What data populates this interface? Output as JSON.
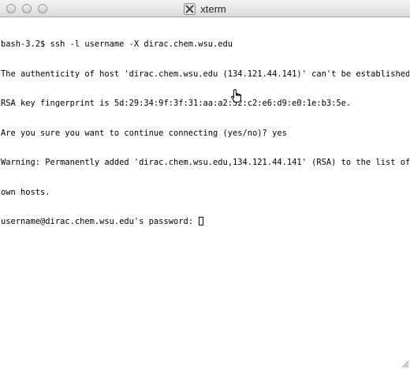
{
  "window": {
    "title": "xterm"
  },
  "terminal": {
    "lines": [
      "bash-3.2$ ssh -l username -X dirac.chem.wsu.edu",
      "The authenticity of host 'dirac.chem.wsu.edu (134.121.44.141)' can't be established.",
      "RSA key fingerprint is 5d:29:34:9f:3f:31:aa:a2:52:c2:e6:d9:e0:1e:b3:5e.",
      "Are you sure you want to continue connecting (yes/no)? yes",
      "Warning: Permanently added 'dirac.chem.wsu.edu,134.121.44.141' (RSA) to the list of kn",
      "own hosts.",
      "username@dirac.chem.wsu.edu's password: "
    ]
  },
  "icons": {
    "close": "close-button",
    "minimize": "minimize-button",
    "zoom": "zoom-button",
    "app": "x11-icon",
    "pointer": "hand-pointer-icon",
    "resize": "resize-grip-icon"
  }
}
